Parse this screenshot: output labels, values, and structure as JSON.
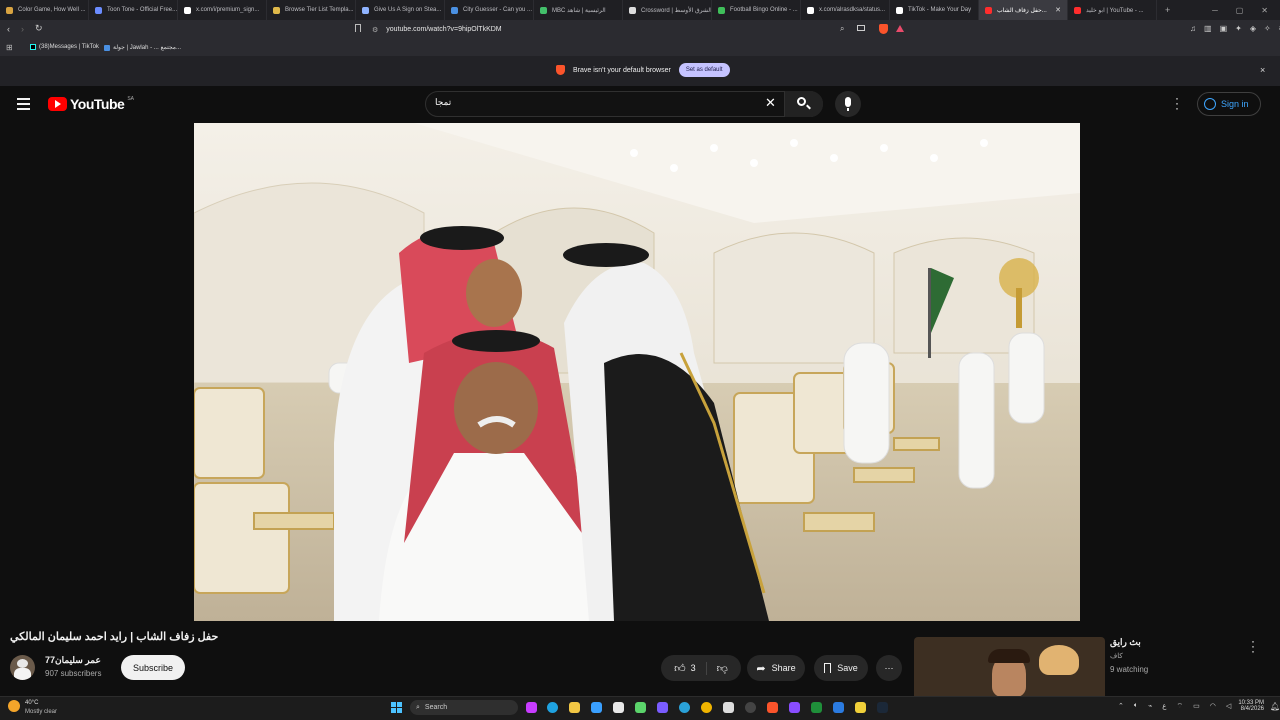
{
  "browser": {
    "tabs": [
      {
        "title": "Color Game, How Well ...",
        "color": "#d9a441"
      },
      {
        "title": "Toon Tone - Official Free...",
        "color": "#6b8cff"
      },
      {
        "title": "x.com/i/premium_sign...",
        "color": "#ffffff"
      },
      {
        "title": "Browse Tier List Templa...",
        "color": "#e0b94a"
      },
      {
        "title": "Give Us A Sign on Stea...",
        "color": "#8fb3ff"
      },
      {
        "title": "City Guesser - Can you ...",
        "color": "#4a90e2"
      },
      {
        "title": "MBC الرئيسية | شاهد",
        "color": "#43c06b"
      },
      {
        "title": "Crossword | الشرق الأوسط",
        "color": "#dddddd"
      },
      {
        "title": "Football Bingo Online - ...",
        "color": "#3fbf5a"
      },
      {
        "title": "x.com/alrasdksa/status...",
        "color": "#ffffff"
      },
      {
        "title": "TikTok - Make Your Day",
        "color": "#ffffff"
      },
      {
        "title": "حفل زفاف الشاب...",
        "color": "#ff2d2d",
        "active": true
      },
      {
        "title": "ابو خليد | YouTube - ...",
        "color": "#ff2d2d"
      }
    ],
    "new_tab": "+",
    "url": "youtube.com/watch?v=9hipOlTkKDM",
    "bookmarks": [
      {
        "label": "(38)Messages | TikTok"
      },
      {
        "label": "جولة | Jawlah - ... مجتمع..."
      }
    ],
    "notification": {
      "text": "Brave isn't your default browser",
      "button": "Set as default",
      "close": "×"
    }
  },
  "youtube": {
    "logo_text": "YouTube",
    "region": "SA",
    "search_value": "تمجا",
    "signin": "Sign in",
    "video_title": "حفل زفاف الشاب | رايد احمد سليمان المالكي",
    "channel_name": "عمر سليمان77",
    "subscribers": "907 subscribers",
    "subscribe": "Subscribe",
    "likes": "3",
    "share": "Share",
    "save": "Save",
    "more": "⋯",
    "side": {
      "title": "بث رايق",
      "channel": "كاف",
      "watching": "9 watching"
    }
  },
  "taskbar": {
    "weather_temp": "40°C",
    "weather_desc": "Mostly clear",
    "search": "Search",
    "time": "10:33 PM",
    "date": "8/4/2026"
  },
  "colors": {
    "accent": "#3ea6ff",
    "youtube_red": "#ff0000",
    "background": "#0f0f0f"
  }
}
